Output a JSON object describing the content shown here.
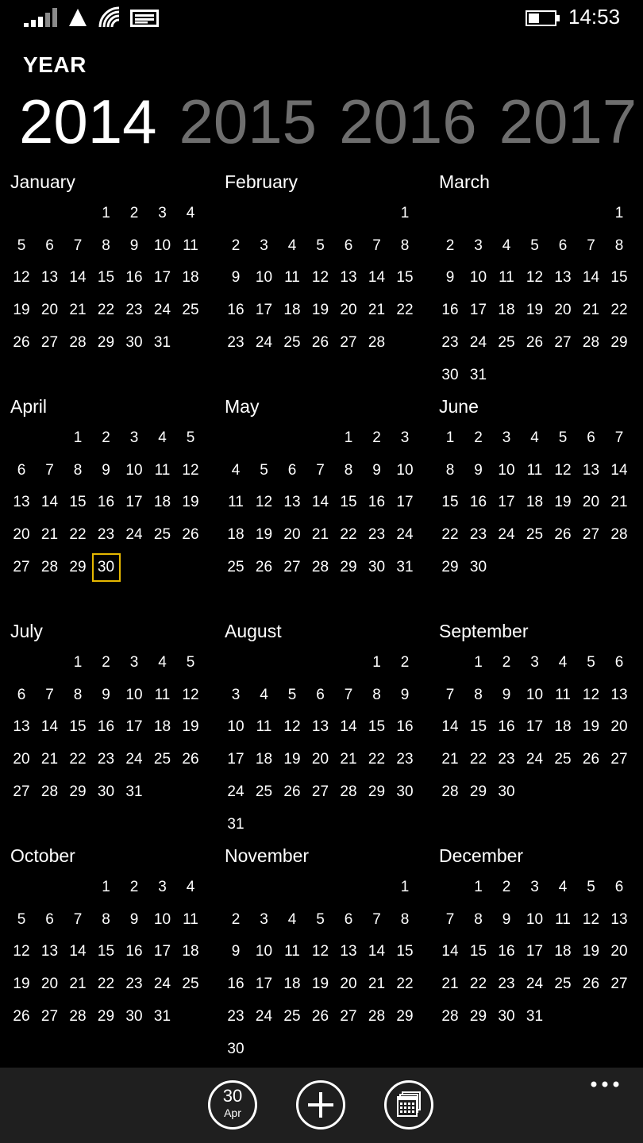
{
  "status_bar": {
    "time": "14:53",
    "icons": [
      "signal-icon",
      "network-triangle-icon",
      "wifi-icon",
      "message-icon",
      "battery-icon"
    ]
  },
  "header": {
    "label": "YEAR",
    "years": [
      "2014",
      "2015",
      "2016",
      "2017",
      "20"
    ],
    "active_year": "2014"
  },
  "months": [
    {
      "name": "January",
      "start": 3,
      "days": 31
    },
    {
      "name": "February",
      "start": 6,
      "days": 28
    },
    {
      "name": "March",
      "start": 6,
      "days": 31
    },
    {
      "name": "April",
      "start": 2,
      "days": 30
    },
    {
      "name": "May",
      "start": 4,
      "days": 31
    },
    {
      "name": "June",
      "start": 0,
      "days": 30
    },
    {
      "name": "July",
      "start": 2,
      "days": 31
    },
    {
      "name": "August",
      "start": 5,
      "days": 31
    },
    {
      "name": "September",
      "start": 1,
      "days": 30
    },
    {
      "name": "October",
      "start": 3,
      "days": 31
    },
    {
      "name": "November",
      "start": 6,
      "days": 30
    },
    {
      "name": "December",
      "start": 1,
      "days": 31
    }
  ],
  "today": {
    "month_index": 3,
    "day": 30
  },
  "app_bar": {
    "today_day": "30",
    "today_month": "Apr",
    "buttons": [
      "today-button",
      "add-event-button",
      "calendar-view-button"
    ],
    "more": "more-options"
  },
  "colors": {
    "background": "#000000",
    "inactive_year": "#6e6e6e",
    "today_accent": "#e6b800",
    "app_bar": "#1f1f1f"
  }
}
